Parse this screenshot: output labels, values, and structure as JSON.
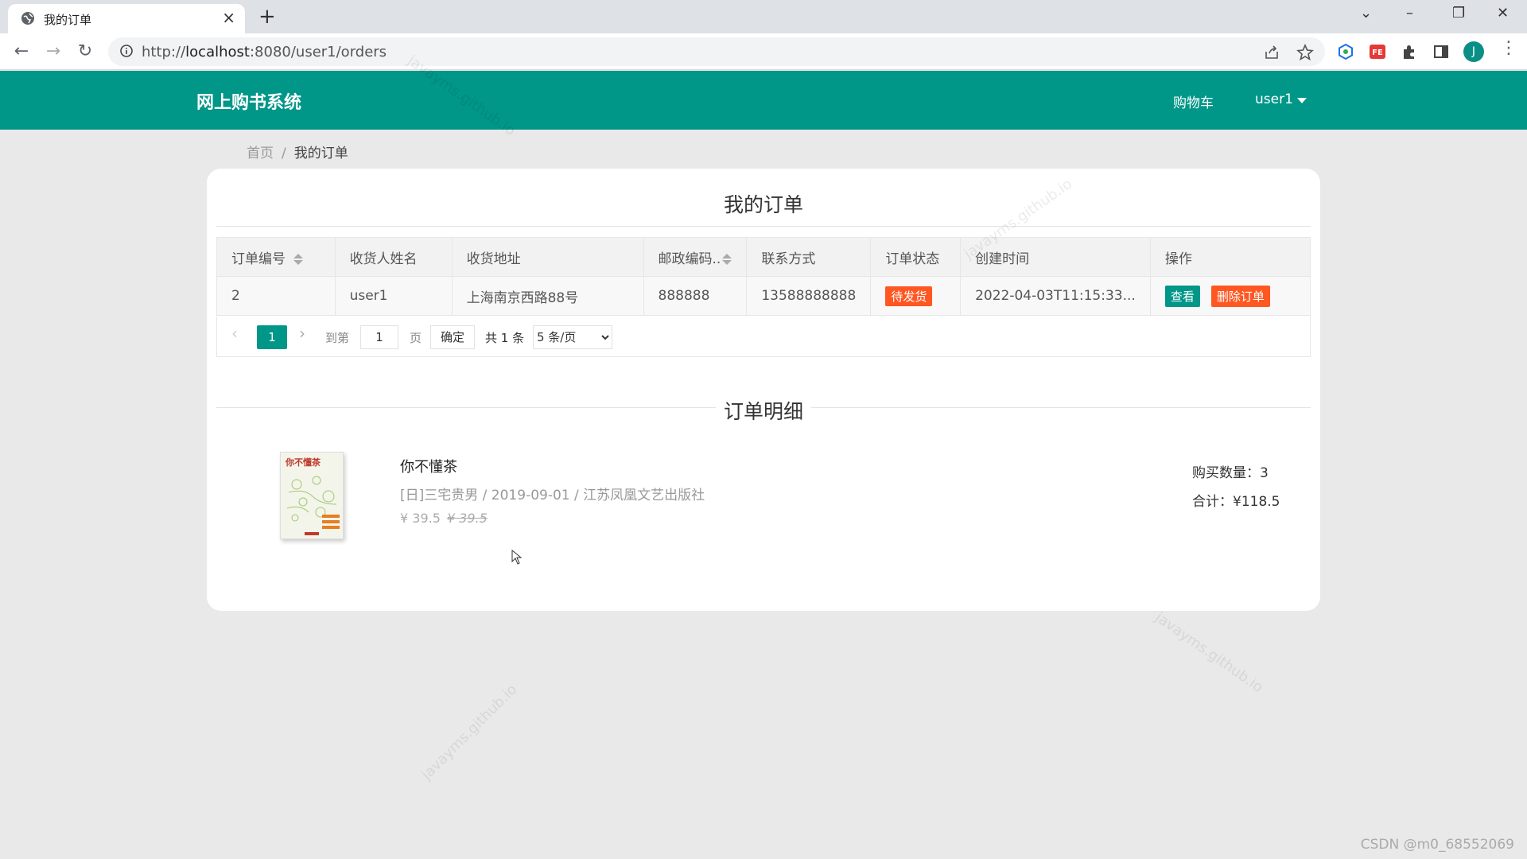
{
  "browser": {
    "tab_title": "我的订单",
    "url_prefix": "http://",
    "url_host": "localhost",
    "url_rest": ":8080/user1/orders",
    "avatar_letter": "J"
  },
  "header": {
    "logo": "网上购书系统",
    "cart": "购物车",
    "user": "user1"
  },
  "breadcrumb": {
    "home": "首页",
    "separator": "/",
    "current": "我的订单"
  },
  "orders": {
    "title": "我的订单",
    "columns": [
      "订单编号",
      "收货人姓名",
      "收货地址",
      "邮政编码..",
      "联系方式",
      "订单状态",
      "创建时间",
      "操作"
    ],
    "rows": [
      {
        "id": "2",
        "name": "user1",
        "address": "上海南京西路88号",
        "zip": "888888",
        "phone": "13588888888",
        "status": "待发货",
        "created": "2022-04-03T11:15:33...",
        "view_label": "查看",
        "delete_label": "删除订单"
      }
    ]
  },
  "pager": {
    "current": "1",
    "goto_label": "到第",
    "goto_value": "1",
    "page_label": "页",
    "confirm": "确定",
    "total": "共 1 条",
    "limit": "5 条/页"
  },
  "detail": {
    "title": "订单明细",
    "book_name": "你不懂茶",
    "book_meta": "[日]三宅贵男 / 2019-09-01 / 江苏凤凰文艺出版社",
    "price": "¥ 39.5",
    "old_price": "¥ 39.5",
    "quantity": "购买数量：3",
    "total": "合计：¥118.5",
    "cover_text": "你不懂茶"
  },
  "watermark": "javayms.github.io",
  "footer": "CSDN @m0_68552069",
  "colors": {
    "primary": "#009688",
    "danger": "#ff5722"
  }
}
